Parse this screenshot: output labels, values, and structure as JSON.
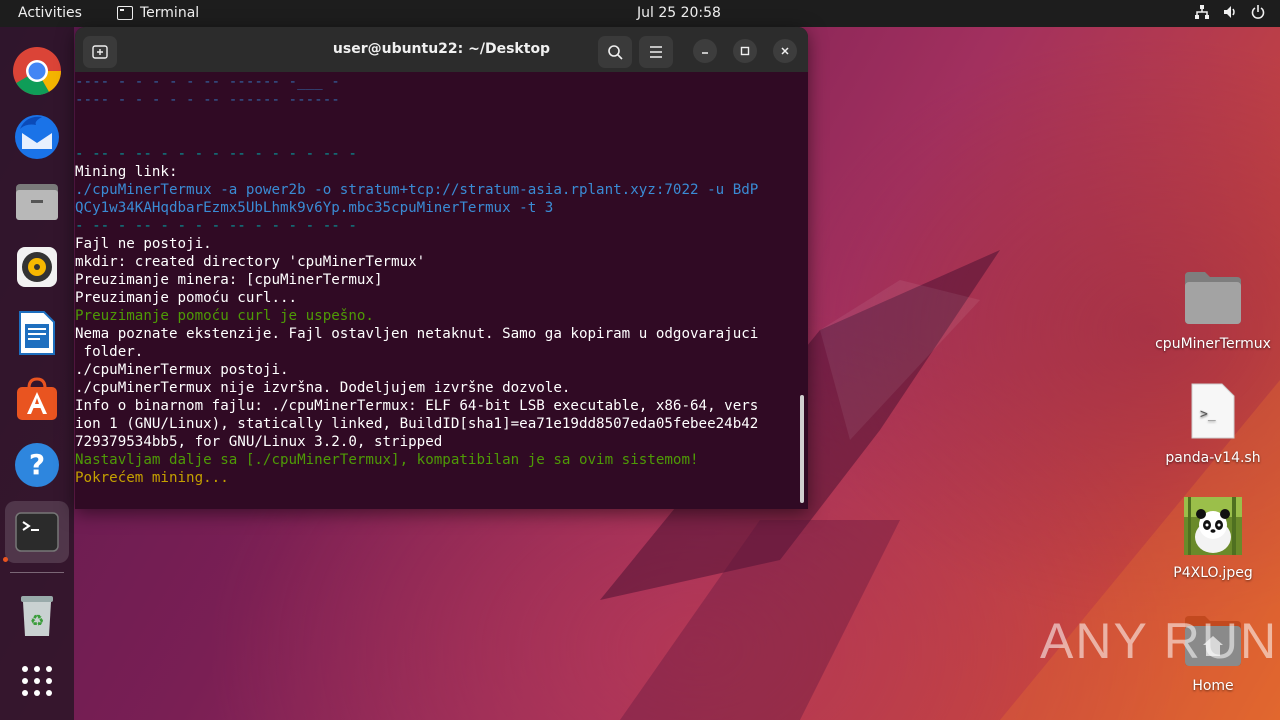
{
  "topbar": {
    "activities": "Activities",
    "app_name": "Terminal",
    "clock": "Jul 25  20:58"
  },
  "dock": {
    "items": [
      {
        "name": "chrome"
      },
      {
        "name": "thunderbird"
      },
      {
        "name": "files"
      },
      {
        "name": "rhythmbox"
      },
      {
        "name": "writer"
      },
      {
        "name": "software"
      },
      {
        "name": "help"
      },
      {
        "name": "terminal"
      },
      {
        "name": "trash"
      },
      {
        "name": "show-apps"
      }
    ]
  },
  "terminal": {
    "title": "user@ubuntu22: ~/Desktop",
    "lines": [
      {
        "text": "---- - - - - - -- ------ -___ -",
        "cls": "c-dash"
      },
      {
        "text": "---- - - - - - -- ------ ------",
        "cls": "c-dash"
      },
      {
        "text": "",
        "cls": ""
      },
      {
        "text": "",
        "cls": ""
      },
      {
        "text": "- -- - -- - - - - -- - - - - -- -",
        "cls": "c-cyan"
      },
      {
        "text": "Mining link:",
        "cls": ""
      },
      {
        "text": "./cpuMinerTermux -a power2b -o stratum+tcp://stratum-asia.rplant.xyz:7022 -u BdP",
        "cls": "c-blue"
      },
      {
        "text": "QCy1w34KAHqdbarEzmx5UbLhmk9v6Yp.mbc35cpuMinerTermux -t 3",
        "cls": "c-blue"
      },
      {
        "text": "- -- - -- - - - - -- - - - - -- -",
        "cls": "c-cyan"
      },
      {
        "text": "Fajl ne postoji.",
        "cls": ""
      },
      {
        "text": "mkdir: created directory 'cpuMinerTermux'",
        "cls": ""
      },
      {
        "text": "Preuzimanje minera: [cpuMinerTermux]",
        "cls": ""
      },
      {
        "text": "Preuzimanje pomoću curl...",
        "cls": ""
      },
      {
        "text": "Preuzimanje pomoću curl je uspešno.",
        "cls": "c-green"
      },
      {
        "text": "Nema poznate ekstenzije. Fajl ostavljen netaknut. Samo ga kopiram u odgovarajuci",
        "cls": ""
      },
      {
        "text": " folder.",
        "cls": ""
      },
      {
        "text": "./cpuMinerTermux postoji.",
        "cls": ""
      },
      {
        "text": "./cpuMinerTermux nije izvršna. Dodeljujem izvršne dozvole.",
        "cls": ""
      },
      {
        "text": "Info o binarnom fajlu: ./cpuMinerTermux: ELF 64-bit LSB executable, x86-64, vers",
        "cls": ""
      },
      {
        "text": "ion 1 (GNU/Linux), statically linked, BuildID[sha1]=ea71e19dd8507eda05febee24b42",
        "cls": ""
      },
      {
        "text": "729379534bb5, for GNU/Linux 3.2.0, stripped",
        "cls": ""
      },
      {
        "text": "Nastavljam dalje sa [./cpuMinerTermux], kompatibilan je sa ovim sistemom!",
        "cls": "c-green"
      },
      {
        "text": "Pokrećem mining...",
        "cls": "c-orange"
      }
    ]
  },
  "desktop": {
    "items": [
      {
        "label": "cpuMinerTermux",
        "icon": "folder-icon"
      },
      {
        "label": "panda-v14.sh",
        "icon": "script-file-icon"
      },
      {
        "label": "P4XLO.jpeg",
        "icon": "image-thumbnail"
      },
      {
        "label": "Home",
        "icon": "home-folder-icon"
      }
    ]
  },
  "watermark": "ANY RUN"
}
